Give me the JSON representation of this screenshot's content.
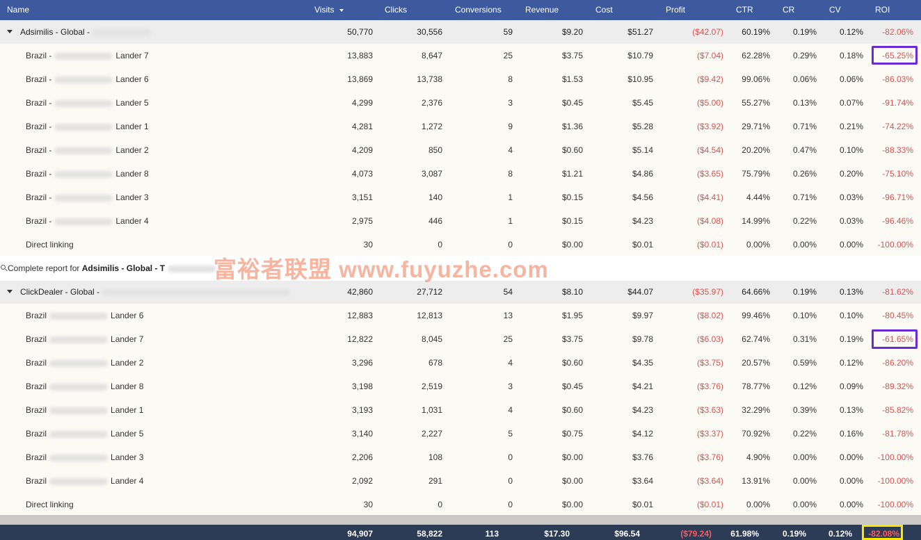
{
  "columns": {
    "name": "Name",
    "visits": "Visits",
    "clicks": "Clicks",
    "conversions": "Conversions",
    "revenue": "Revenue",
    "cost": "Cost",
    "profit": "Profit",
    "ctr": "CTR",
    "cr": "CR",
    "cv": "CV",
    "roi": "ROI"
  },
  "groups": [
    {
      "name": "Adsimilis - Global -",
      "totals": {
        "visits": "50,770",
        "clicks": "30,556",
        "conversions": "59",
        "revenue": "$9.20",
        "cost": "$51.27",
        "profit": "($42.07)",
        "ctr": "60.19%",
        "cr": "0.19%",
        "cv": "0.12%",
        "roi": "-82.06%"
      },
      "rows": [
        {
          "prefix": "Brazil -",
          "suffix": "Lander 7",
          "visits": "13,883",
          "clicks": "8,647",
          "conversions": "25",
          "revenue": "$3.75",
          "cost": "$10.79",
          "profit": "($7.04)",
          "ctr": "62.28%",
          "cr": "0.29%",
          "cv": "0.18%",
          "roi": "-65.25%"
        },
        {
          "prefix": "Brazil -",
          "suffix": "Lander 6",
          "visits": "13,869",
          "clicks": "13,738",
          "conversions": "8",
          "revenue": "$1.53",
          "cost": "$10.95",
          "profit": "($9.42)",
          "ctr": "99.06%",
          "cr": "0.06%",
          "cv": "0.06%",
          "roi": "-86.03%"
        },
        {
          "prefix": "Brazil -",
          "suffix": "Lander 5",
          "visits": "4,299",
          "clicks": "2,376",
          "conversions": "3",
          "revenue": "$0.45",
          "cost": "$5.45",
          "profit": "($5.00)",
          "ctr": "55.27%",
          "cr": "0.13%",
          "cv": "0.07%",
          "roi": "-91.74%"
        },
        {
          "prefix": "Brazil -",
          "suffix": "Lander 1",
          "visits": "4,281",
          "clicks": "1,272",
          "conversions": "9",
          "revenue": "$1.36",
          "cost": "$5.28",
          "profit": "($3.92)",
          "ctr": "29.71%",
          "cr": "0.71%",
          "cv": "0.21%",
          "roi": "-74.22%"
        },
        {
          "prefix": "Brazil -",
          "suffix": "Lander 2",
          "visits": "4,209",
          "clicks": "850",
          "conversions": "4",
          "revenue": "$0.60",
          "cost": "$5.14",
          "profit": "($4.54)",
          "ctr": "20.20%",
          "cr": "0.47%",
          "cv": "0.10%",
          "roi": "-88.33%"
        },
        {
          "prefix": "Brazil -",
          "suffix": "Lander 8",
          "visits": "4,073",
          "clicks": "3,087",
          "conversions": "8",
          "revenue": "$1.21",
          "cost": "$4.86",
          "profit": "($3.65)",
          "ctr": "75.79%",
          "cr": "0.26%",
          "cv": "0.20%",
          "roi": "-75.10%"
        },
        {
          "prefix": "Brazil -",
          "suffix": "Lander 3",
          "visits": "3,151",
          "clicks": "140",
          "conversions": "1",
          "revenue": "$0.15",
          "cost": "$4.56",
          "profit": "($4.41)",
          "ctr": "4.44%",
          "cr": "0.71%",
          "cv": "0.03%",
          "roi": "-96.71%"
        },
        {
          "prefix": "Brazil -",
          "suffix": "Lander 4",
          "visits": "2,975",
          "clicks": "446",
          "conversions": "1",
          "revenue": "$0.15",
          "cost": "$4.23",
          "profit": "($4.08)",
          "ctr": "14.99%",
          "cr": "0.22%",
          "cv": "0.03%",
          "roi": "-96.46%"
        },
        {
          "prefix": "Direct linking",
          "suffix": "",
          "visits": "30",
          "clicks": "0",
          "conversions": "0",
          "revenue": "$0.00",
          "cost": "$0.01",
          "profit": "($0.01)",
          "ctr": "0.00%",
          "cr": "0.00%",
          "cv": "0.00%",
          "roi": "-100.00%"
        }
      ]
    },
    {
      "name": "ClickDealer - Global -",
      "totals": {
        "visits": "42,860",
        "clicks": "27,712",
        "conversions": "54",
        "revenue": "$8.10",
        "cost": "$44.07",
        "profit": "($35.97)",
        "ctr": "64.66%",
        "cr": "0.19%",
        "cv": "0.13%",
        "roi": "-81.62%"
      },
      "rows": [
        {
          "prefix": "Brazil",
          "suffix": "Lander 6",
          "visits": "12,883",
          "clicks": "12,813",
          "conversions": "13",
          "revenue": "$1.95",
          "cost": "$9.97",
          "profit": "($8.02)",
          "ctr": "99.46%",
          "cr": "0.10%",
          "cv": "0.10%",
          "roi": "-80.45%"
        },
        {
          "prefix": "Brazil",
          "suffix": "Lander 7",
          "visits": "12,822",
          "clicks": "8,045",
          "conversions": "25",
          "revenue": "$3.75",
          "cost": "$9.78",
          "profit": "($6.03)",
          "ctr": "62.74%",
          "cr": "0.31%",
          "cv": "0.19%",
          "roi": "-61.65%"
        },
        {
          "prefix": "Brazil",
          "suffix": "Lander 2",
          "visits": "3,296",
          "clicks": "678",
          "conversions": "4",
          "revenue": "$0.60",
          "cost": "$4.35",
          "profit": "($3.75)",
          "ctr": "20.57%",
          "cr": "0.59%",
          "cv": "0.12%",
          "roi": "-86.20%"
        },
        {
          "prefix": "Brazil",
          "suffix": "Lander 8",
          "visits": "3,198",
          "clicks": "2,519",
          "conversions": "3",
          "revenue": "$0.45",
          "cost": "$4.21",
          "profit": "($3.76)",
          "ctr": "78.77%",
          "cr": "0.12%",
          "cv": "0.09%",
          "roi": "-89.32%"
        },
        {
          "prefix": "Brazil",
          "suffix": "Lander 1",
          "visits": "3,193",
          "clicks": "1,031",
          "conversions": "4",
          "revenue": "$0.60",
          "cost": "$4.23",
          "profit": "($3.63)",
          "ctr": "32.29%",
          "cr": "0.39%",
          "cv": "0.13%",
          "roi": "-85.82%"
        },
        {
          "prefix": "Brazil",
          "suffix": "Lander 5",
          "visits": "3,140",
          "clicks": "2,227",
          "conversions": "5",
          "revenue": "$0.75",
          "cost": "$4.12",
          "profit": "($3.37)",
          "ctr": "70.92%",
          "cr": "0.22%",
          "cv": "0.16%",
          "roi": "-81.78%"
        },
        {
          "prefix": "Brazil",
          "suffix": "Lander 3",
          "visits": "2,206",
          "clicks": "108",
          "conversions": "0",
          "revenue": "$0.00",
          "cost": "$3.76",
          "profit": "($3.76)",
          "ctr": "4.90%",
          "cr": "0.00%",
          "cv": "0.00%",
          "roi": "-100.00%"
        },
        {
          "prefix": "Brazil",
          "suffix": "Lander 4",
          "visits": "2,092",
          "clicks": "291",
          "conversions": "0",
          "revenue": "$0.00",
          "cost": "$3.64",
          "profit": "($3.64)",
          "ctr": "13.91%",
          "cr": "0.00%",
          "cv": "0.00%",
          "roi": "-100.00%"
        },
        {
          "prefix": "Direct linking",
          "suffix": "",
          "visits": "30",
          "clicks": "0",
          "conversions": "0",
          "revenue": "$0.00",
          "cost": "$0.01",
          "profit": "($0.01)",
          "ctr": "0.00%",
          "cr": "0.00%",
          "cv": "0.00%",
          "roi": "-100.00%"
        }
      ]
    }
  ],
  "report_link": {
    "prefix": "Complete report for",
    "target": "Adsimilis - Global -",
    "tail": "T"
  },
  "footer": {
    "visits": "94,907",
    "clicks": "58,822",
    "conversions": "113",
    "revenue": "$17.30",
    "cost": "$96.54",
    "profit": "($79.24)",
    "ctr": "61.98%",
    "cr": "0.19%",
    "cv": "0.12%",
    "roi": "-82.08%"
  },
  "watermark": "富裕者联盟 www.fuyuzhe.com",
  "colors": {
    "header": "#3d5a9e",
    "negative": "#d9534f",
    "highlight_purple": "#6a2bd6",
    "highlight_yellow": "#ffe600",
    "footer": "#2c3b56"
  }
}
